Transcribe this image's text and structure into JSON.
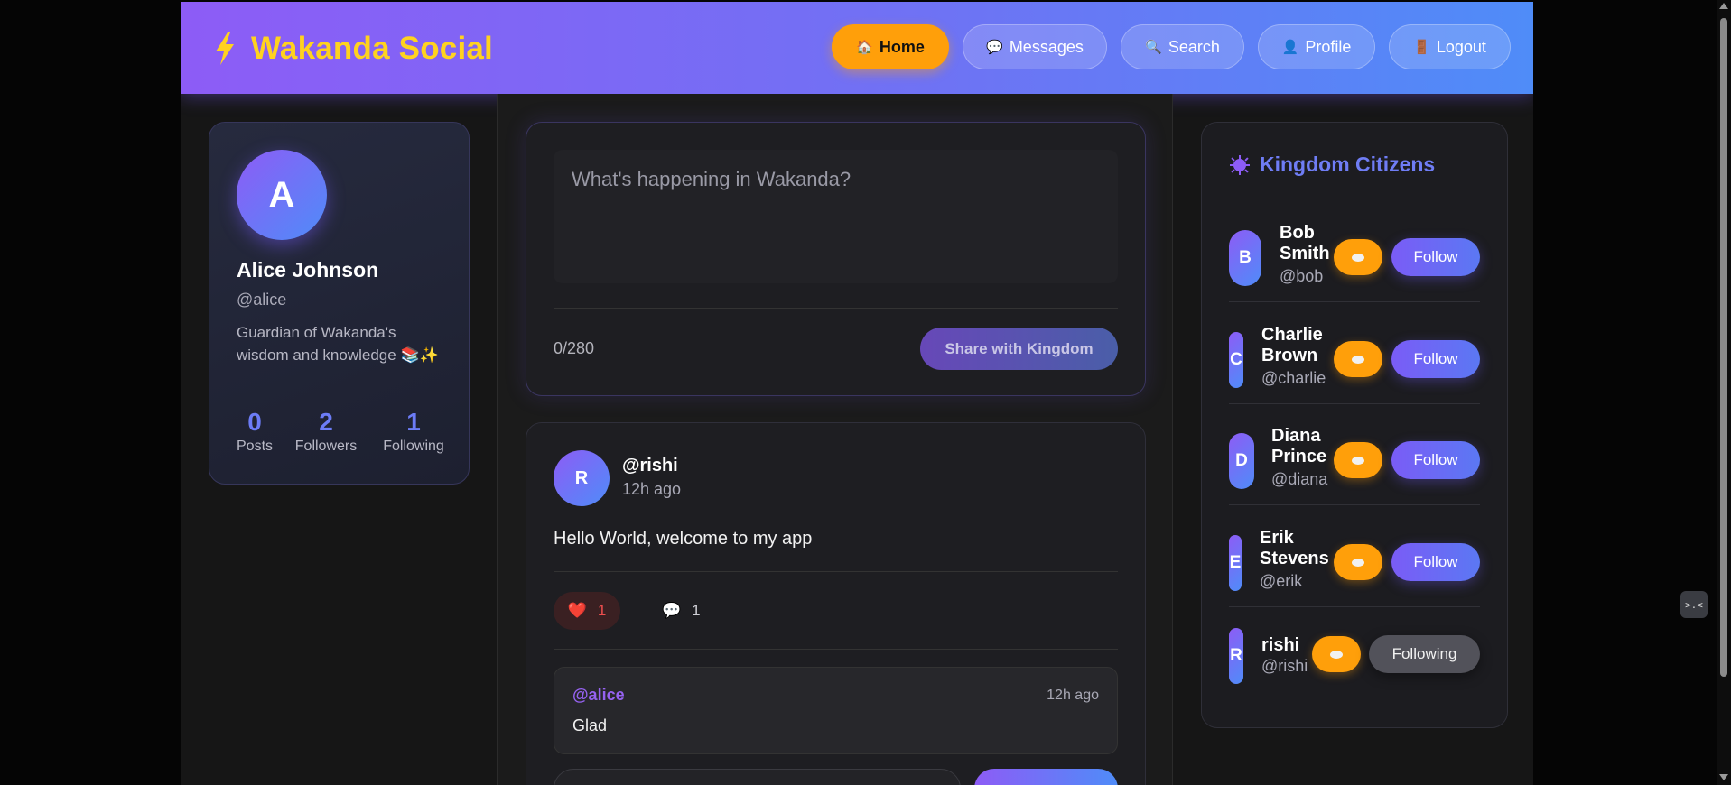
{
  "app": {
    "brand": "Wakanda Social",
    "brand_icon": "lightning-icon",
    "brand_color": "#ffd21f",
    "accent_gradient": [
      "#8d5cf6",
      "#4f8cf8"
    ]
  },
  "nav": {
    "items": [
      {
        "label": "Home",
        "icon": "🏠",
        "active": true
      },
      {
        "label": "Messages",
        "icon": "💬",
        "active": false
      },
      {
        "label": "Search",
        "icon": "🔍",
        "active": false
      },
      {
        "label": "Profile",
        "icon": "👤",
        "active": false
      },
      {
        "label": "Logout",
        "icon": "🚪",
        "active": false
      }
    ]
  },
  "profile": {
    "initial": "A",
    "name": "Alice Johnson",
    "handle": "@alice",
    "bio": "Guardian of Wakanda's wisdom and knowledge 📚✨",
    "stats": [
      {
        "value": "0",
        "label": "Posts"
      },
      {
        "value": "2",
        "label": "Followers"
      },
      {
        "value": "1",
        "label": "Following"
      }
    ]
  },
  "composer": {
    "placeholder": "What's happening in Wakanda?",
    "char_count": "0/280",
    "share_label": "Share with Kingdom"
  },
  "feed": {
    "post": {
      "avatar_initial": "R",
      "user": "@rishi",
      "time": "12h ago",
      "text": "Hello World, welcome to my app",
      "like_icon": "❤️",
      "likes": "1",
      "comment_icon": "💬",
      "comments": "1",
      "comment_list": [
        {
          "user": "@alice",
          "time": "12h ago",
          "text": "Glad"
        }
      ]
    }
  },
  "citizens": {
    "title": "Kingdom Citizens",
    "title_icon": "sun-badge-icon",
    "users": [
      {
        "initial": "B",
        "name": "Bob Smith",
        "handle": "@bob",
        "follow_label": "Follow",
        "following": false
      },
      {
        "initial": "C",
        "name": "Charlie Brown",
        "handle": "@charlie",
        "follow_label": "Follow",
        "following": false
      },
      {
        "initial": "D",
        "name": "Diana Prince",
        "handle": "@diana",
        "follow_label": "Follow",
        "following": false
      },
      {
        "initial": "E",
        "name": "Erik Stevens",
        "handle": "@erik",
        "follow_label": "Follow",
        "following": false
      },
      {
        "initial": "R",
        "name": "rishi",
        "handle": "@rishi",
        "follow_label": "Following",
        "following": true
      }
    ]
  },
  "extension_widget": {
    "icon": "code-icon",
    "glyph": ">.<"
  }
}
